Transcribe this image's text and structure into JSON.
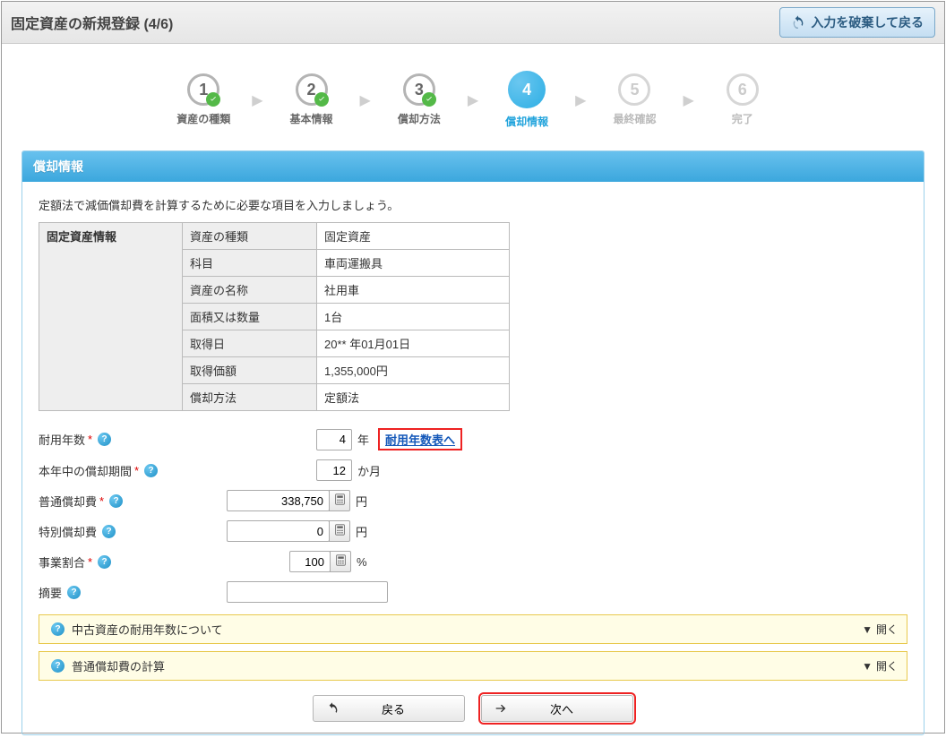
{
  "header": {
    "title": "固定資産の新規登録 (4/6)",
    "discard_label": "入力を破棄して戻る"
  },
  "steps": [
    {
      "num": "1",
      "label": "資産の種類",
      "state": "done"
    },
    {
      "num": "2",
      "label": "基本情報",
      "state": "done"
    },
    {
      "num": "3",
      "label": "償却方法",
      "state": "done"
    },
    {
      "num": "4",
      "label": "償却情報",
      "state": "active"
    },
    {
      "num": "5",
      "label": "最終確認",
      "state": "future"
    },
    {
      "num": "6",
      "label": "完了",
      "state": "future"
    }
  ],
  "panel": {
    "title": "償却情報",
    "intro": "定額法で減価償却費を計算するために必要な項目を入力しましょう。"
  },
  "info_table": {
    "group_label": "固定資産情報",
    "rows": [
      {
        "label": "資産の種類",
        "value": "固定資産"
      },
      {
        "label": "科目",
        "value": "車両運搬具"
      },
      {
        "label": "資産の名称",
        "value": "社用車"
      },
      {
        "label": "面積又は数量",
        "value": "1台"
      },
      {
        "label": "取得日",
        "value": "20** 年01月01日"
      },
      {
        "label": "取得価額",
        "value": "1,355,000円"
      },
      {
        "label": "償却方法",
        "value": "定額法"
      }
    ]
  },
  "fields": {
    "useful_life": {
      "label": "耐用年数",
      "value": "4",
      "suffix": "年",
      "link_label": "耐用年数表へ"
    },
    "dep_period": {
      "label": "本年中の償却期間",
      "value": "12",
      "suffix": "か月"
    },
    "ordinary_dep": {
      "label": "普通償却費",
      "value": "338,750",
      "suffix": "円"
    },
    "special_dep": {
      "label": "特別償却費",
      "value": "0",
      "suffix": "円"
    },
    "biz_ratio": {
      "label": "事業割合",
      "value": "100",
      "suffix": "%"
    },
    "summary": {
      "label": "摘要",
      "value": ""
    }
  },
  "accordions": {
    "used_asset": "中古資産の耐用年数について",
    "ordinary_calc": "普通償却費の計算",
    "toggle_label": "開く"
  },
  "buttons": {
    "back": "戻る",
    "next": "次へ"
  }
}
